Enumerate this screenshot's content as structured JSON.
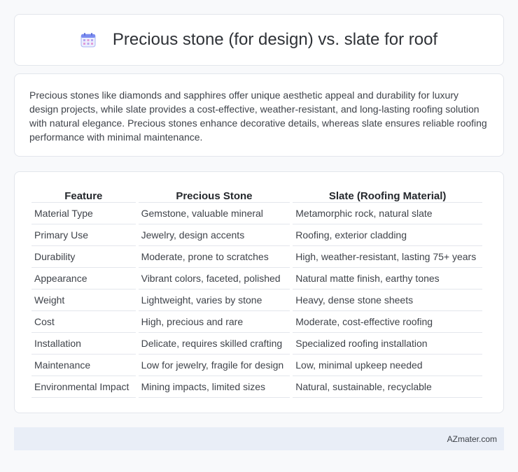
{
  "header": {
    "title": "Precious stone (for design) vs. slate for roof",
    "icon": "calendar-icon"
  },
  "summary": {
    "text": "Precious stones like diamonds and sapphires offer unique aesthetic appeal and durability for luxury design projects, while slate provides a cost-effective, weather-resistant, and long-lasting roofing solution with natural elegance. Precious stones enhance decorative details, whereas slate ensures reliable roofing performance with minimal maintenance."
  },
  "table": {
    "headers": [
      "Feature",
      "Precious Stone",
      "Slate (Roofing Material)"
    ],
    "rows": [
      [
        "Material Type",
        "Gemstone, valuable mineral",
        "Metamorphic rock, natural slate"
      ],
      [
        "Primary Use",
        "Jewelry, design accents",
        "Roofing, exterior cladding"
      ],
      [
        "Durability",
        "Moderate, prone to scratches",
        "High, weather-resistant, lasting 75+ years"
      ],
      [
        "Appearance",
        "Vibrant colors, faceted, polished",
        "Natural matte finish, earthy tones"
      ],
      [
        "Weight",
        "Lightweight, varies by stone",
        "Heavy, dense stone sheets"
      ],
      [
        "Cost",
        "High, precious and rare",
        "Moderate, cost-effective roofing"
      ],
      [
        "Installation",
        "Delicate, requires skilled crafting",
        "Specialized roofing installation"
      ],
      [
        "Maintenance",
        "Low for jewelry, fragile for design",
        "Low, minimal upkeep needed"
      ],
      [
        "Environmental Impact",
        "Mining impacts, limited sizes",
        "Natural, sustainable, recyclable"
      ]
    ]
  },
  "footer": {
    "brand": "AZmater.com"
  },
  "colors": {
    "icon_primary": "#7b8cf0",
    "icon_secondary": "#e39ad8",
    "border": "#e3e6ec",
    "footer_bg": "#e9eef7"
  }
}
